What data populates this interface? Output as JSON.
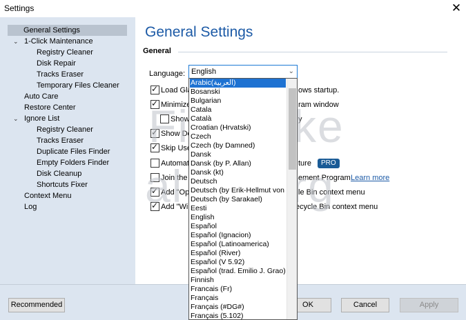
{
  "window": {
    "title": "Settings"
  },
  "sidebar": {
    "items": [
      {
        "label": "General Settings"
      },
      {
        "label": "1-Click Maintenance"
      },
      {
        "label": "Registry Cleaner"
      },
      {
        "label": "Disk Repair"
      },
      {
        "label": "Tracks Eraser"
      },
      {
        "label": "Temporary Files Cleaner"
      },
      {
        "label": "Auto Care"
      },
      {
        "label": "Restore Center"
      },
      {
        "label": "Ignore List"
      },
      {
        "label": "Registry Cleaner"
      },
      {
        "label": "Tracks Eraser"
      },
      {
        "label": "Duplicate Files Finder"
      },
      {
        "label": "Empty Folders Finder"
      },
      {
        "label": "Disk Cleanup"
      },
      {
        "label": "Shortcuts Fixer"
      },
      {
        "label": "Context Menu"
      },
      {
        "label": "Log"
      }
    ]
  },
  "main": {
    "title": "General Settings",
    "section": "General",
    "language": {
      "label": "Language:",
      "selected": "English"
    },
    "options": [
      {
        "visible_text": "Load Gla",
        "visible_text_2": "ows startup.",
        "checked": true
      },
      {
        "visible_text": "Minimize",
        "visible_text_2": "ram window",
        "checked": true
      },
      {
        "visible_text": "Show",
        "visible_text_2": "y",
        "checked": false
      },
      {
        "visible_text": "Show Do",
        "visible_text_2": "",
        "checked": true
      },
      {
        "visible_text": "Skip Use",
        "visible_text_2": "",
        "checked": true
      },
      {
        "visible_text": "Automat",
        "visible_text_2": "ture",
        "checked": false
      },
      {
        "visible_text": "Join the",
        "visible_text_2": "ement Program",
        "checked": false
      },
      {
        "visible_text": "Add \"Op",
        "visible_text_2": "le Bin context menu",
        "checked": true
      },
      {
        "visible_text": "Add \"Wip",
        "visible_text_2": "ecycle Bin context menu",
        "checked": true
      }
    ],
    "pro_badge": "PRO",
    "learn_more": "Learn more"
  },
  "watermark": {
    "line1": "Filemake",
    "line2": "al ba.org"
  },
  "footer": {
    "recommended": "Recommended",
    "ok": "OK",
    "cancel": "Cancel",
    "apply": "Apply"
  },
  "dropdown": {
    "items": [
      "Arabic(العربية)",
      "Bosanski",
      "Bulgarian",
      "Catala",
      "Català",
      "Croatian (Hrvatski)",
      "Czech",
      "Czech (by Damned)",
      "Dansk",
      "Dansk (by P. Allan)",
      "Dansk (kt)",
      "Deutsch",
      "Deutsch (by Erik-Hellmut von",
      "Deutsch (by Sarakael)",
      "Eesti",
      "English",
      "Español",
      "Español (Ignacion)",
      "Español (Latinoamerica)",
      "Español (River)",
      "Español (V 5.92)",
      "Español (trad. Emilio J. Grao)",
      "Finnish",
      "Francais (Fr)",
      "Français",
      "Français (#DG#)",
      "Français (5.102)"
    ]
  },
  "colors": {
    "accent": "#1c5aa6",
    "sidebar_bg": "#dce5f0",
    "selection": "#1e72d2",
    "pro_badge": "#1a5b96"
  }
}
